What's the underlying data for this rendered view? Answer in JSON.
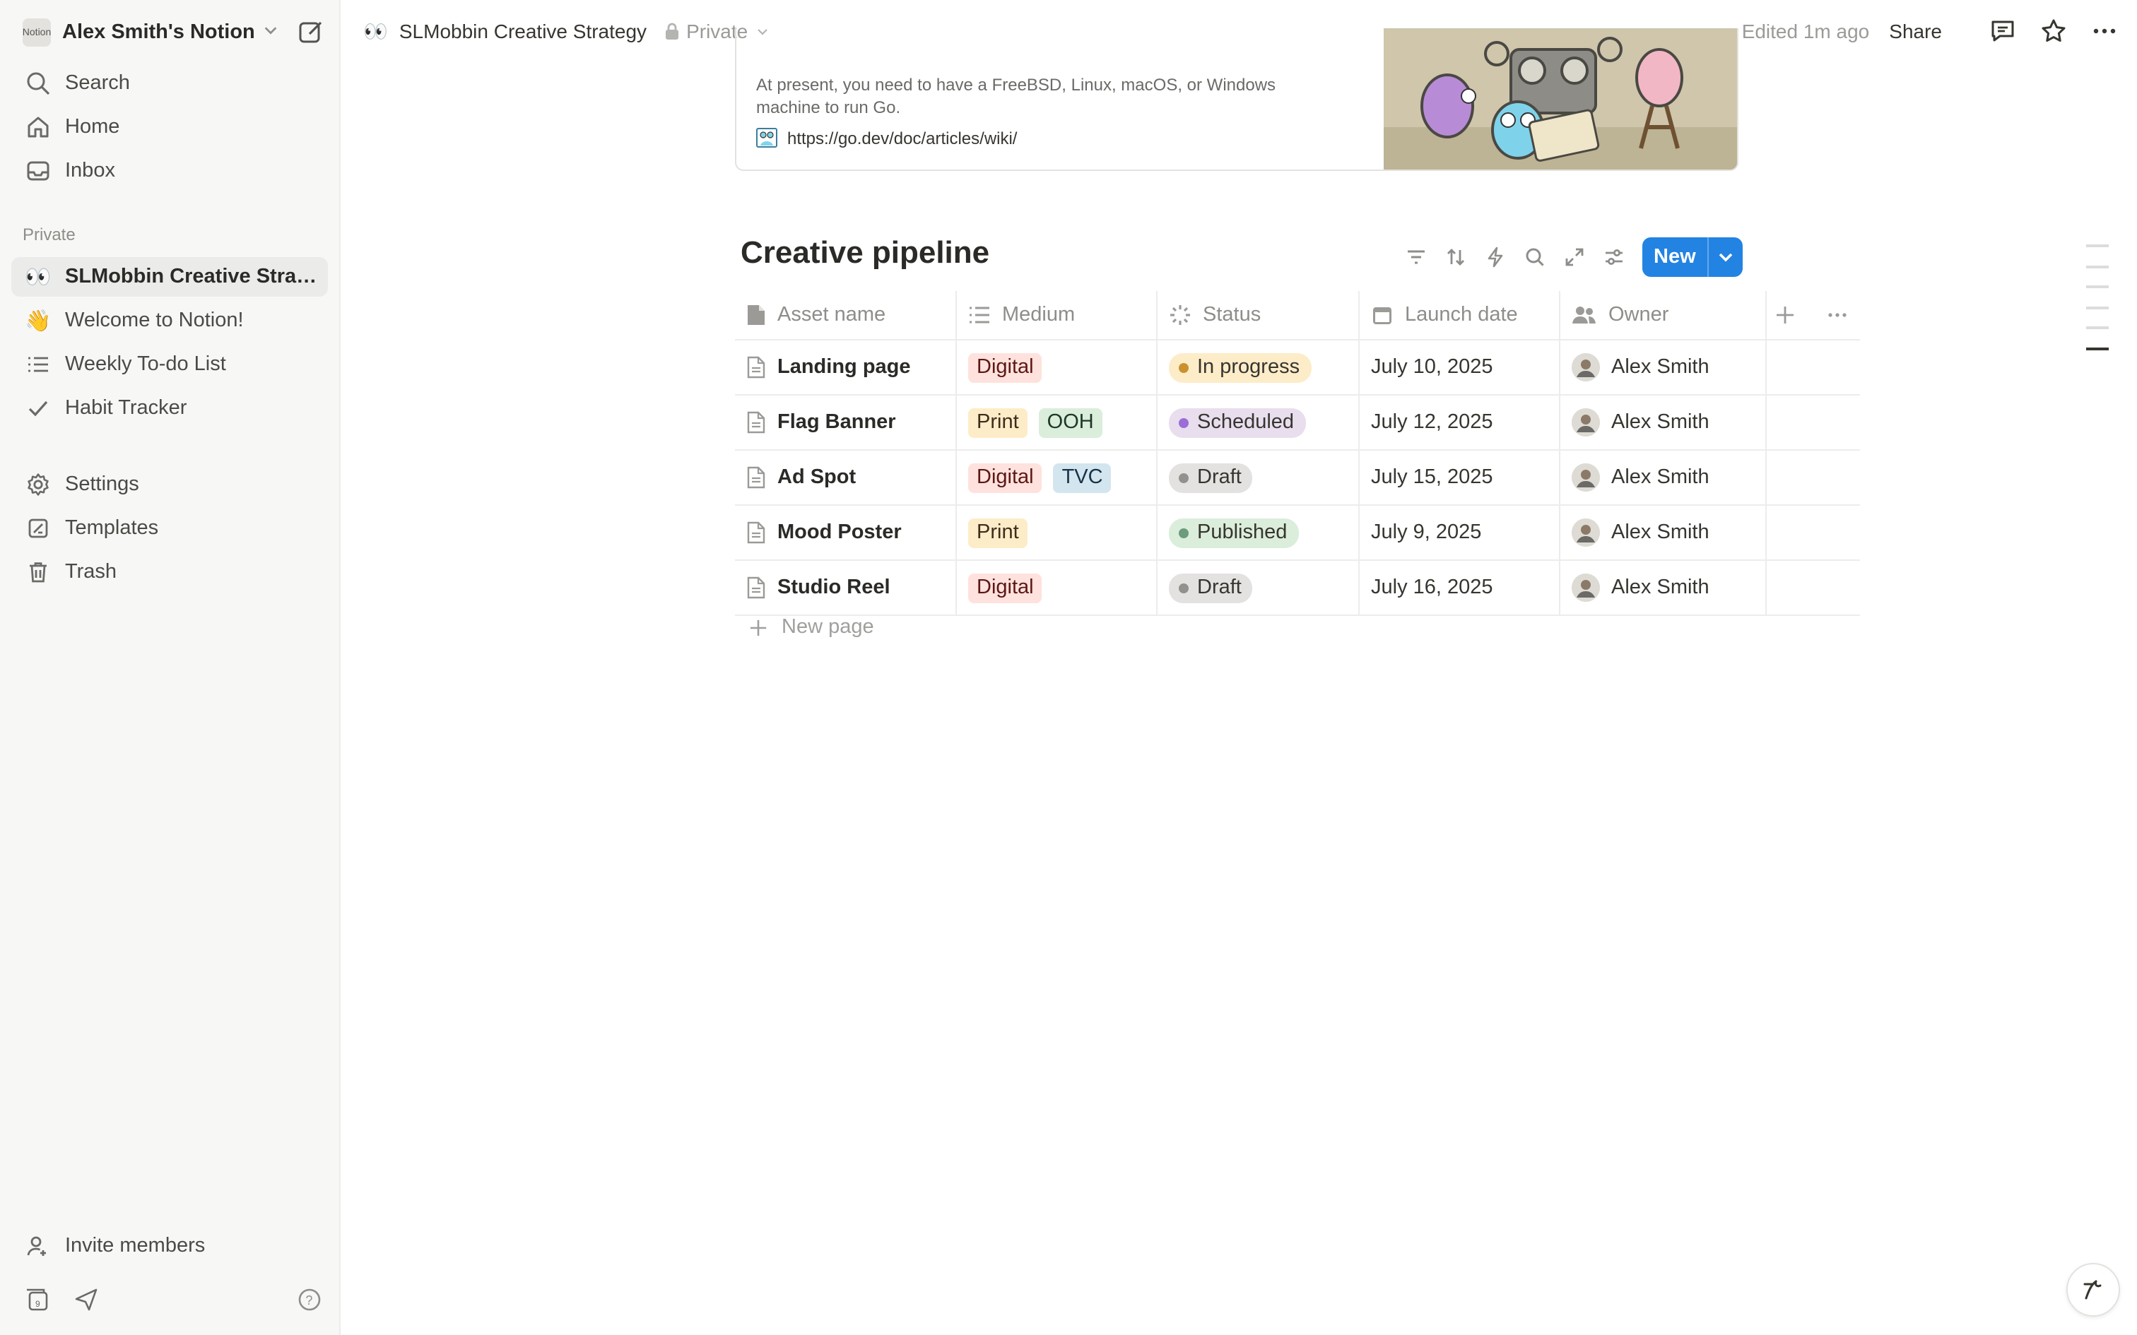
{
  "sidebar": {
    "workspace_icon_text": "Notion",
    "workspace_name": "Alex Smith's Notion",
    "nav": [
      {
        "label": "Search",
        "icon": "search-icon"
      },
      {
        "label": "Home",
        "icon": "home-icon"
      },
      {
        "label": "Inbox",
        "icon": "inbox-icon"
      }
    ],
    "section_label": "Private",
    "pages": [
      {
        "label": "SLMobbin Creative Strat...",
        "icon": "👀",
        "active": true
      },
      {
        "label": "Welcome to Notion!",
        "icon": "👋"
      },
      {
        "label": "Weekly To-do List",
        "icon": "list-icon"
      },
      {
        "label": "Habit Tracker",
        "icon": "check-icon"
      }
    ],
    "utilities": [
      {
        "label": "Settings",
        "icon": "gear-icon"
      },
      {
        "label": "Templates",
        "icon": "templates-icon"
      },
      {
        "label": "Trash",
        "icon": "trash-icon"
      }
    ],
    "invite_label": "Invite members"
  },
  "topbar": {
    "page_emoji": "👀",
    "page_title": "SLMobbin Creative Strategy",
    "privacy": "Private",
    "edited": "Edited 1m ago",
    "share": "Share"
  },
  "bookmark": {
    "description": "At present, you need to have a FreeBSD, Linux, macOS, or Windows machine to run Go.",
    "url": "https://go.dev/doc/articles/wiki/"
  },
  "database": {
    "title": "Creative pipeline",
    "new_button": "New",
    "columns": [
      "Asset name",
      "Medium",
      "Status",
      "Launch date",
      "Owner"
    ],
    "rows": [
      {
        "name": "Landing page",
        "medium": [
          {
            "label": "Digital",
            "bg": "#ffe2dd",
            "fg": "#5d1715"
          }
        ],
        "status": {
          "label": "In progress",
          "bg": "#fdecc8",
          "dot": "#cb912f"
        },
        "date": "July 10, 2025",
        "owner": "Alex Smith"
      },
      {
        "name": "Flag Banner",
        "medium": [
          {
            "label": "Print",
            "bg": "#fdecc8",
            "fg": "#402c1b"
          },
          {
            "label": "OOH",
            "bg": "#dbeddb",
            "fg": "#1c3829"
          }
        ],
        "status": {
          "label": "Scheduled",
          "bg": "#e8deee",
          "dot": "#9a6dd7"
        },
        "date": "July 12, 2025",
        "owner": "Alex Smith"
      },
      {
        "name": "Ad Spot",
        "medium": [
          {
            "label": "Digital",
            "bg": "#ffe2dd",
            "fg": "#5d1715"
          },
          {
            "label": "TVC",
            "bg": "#d3e5ef",
            "fg": "#183347"
          }
        ],
        "status": {
          "label": "Draft",
          "bg": "#e3e2e0",
          "dot": "#91918e"
        },
        "date": "July 15, 2025",
        "owner": "Alex Smith"
      },
      {
        "name": "Mood Poster",
        "medium": [
          {
            "label": "Print",
            "bg": "#fdecc8",
            "fg": "#402c1b"
          }
        ],
        "status": {
          "label": "Published",
          "bg": "#dbeddb",
          "dot": "#6c9b7d"
        },
        "date": "July 9, 2025",
        "owner": "Alex Smith"
      },
      {
        "name": "Studio Reel",
        "medium": [
          {
            "label": "Digital",
            "bg": "#ffe2dd",
            "fg": "#5d1715"
          }
        ],
        "status": {
          "label": "Draft",
          "bg": "#e3e2e0",
          "dot": "#91918e"
        },
        "date": "July 16, 2025",
        "owner": "Alex Smith"
      }
    ],
    "new_page": "New page"
  },
  "colors": {
    "accent": "#2383e2",
    "sidebar_bg": "#f7f7f5",
    "text": "#37352f"
  }
}
